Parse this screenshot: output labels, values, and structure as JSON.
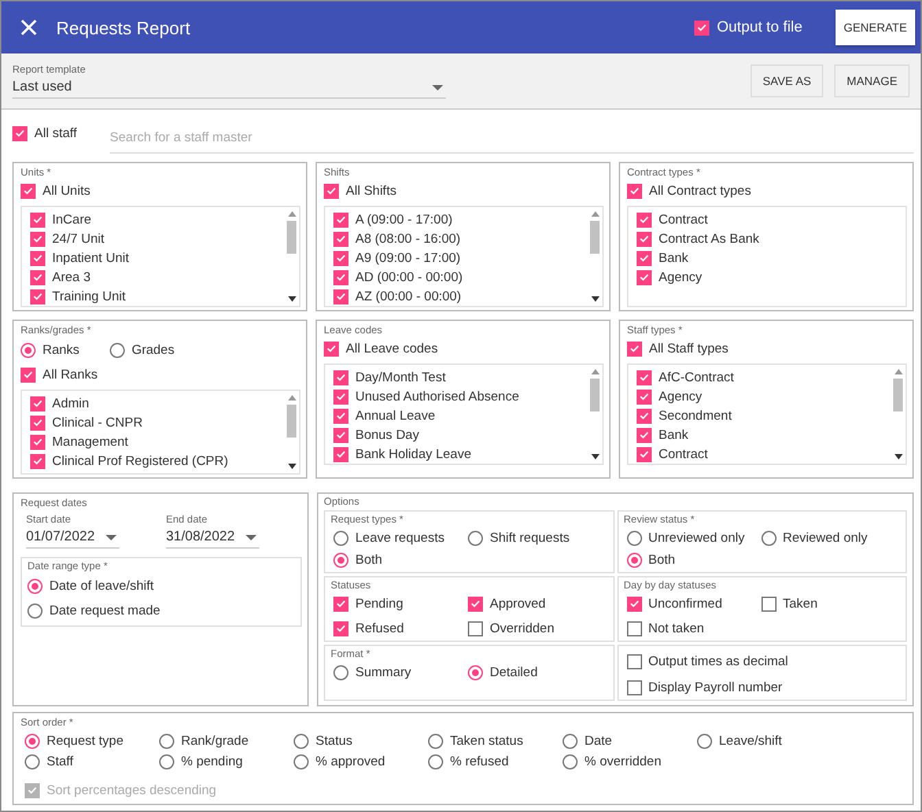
{
  "header": {
    "title": "Requests Report",
    "output_to_file": {
      "label": "Output to file",
      "checked": true
    },
    "generate": "GENERATE"
  },
  "template": {
    "label": "Report template",
    "value": "Last used",
    "buttons": [
      "SAVE AS",
      "MANAGE"
    ]
  },
  "staff": {
    "all_staff": {
      "label": "All staff",
      "checked": true
    },
    "search_placeholder": "Search for a staff master"
  },
  "filters": [
    {
      "title": "Units *",
      "kind": "scroll-list",
      "all": {
        "label": "All Units",
        "checked": true
      },
      "items": [
        {
          "label": "InCare",
          "checked": true
        },
        {
          "label": "24/7 Unit",
          "checked": true
        },
        {
          "label": "Inpatient Unit",
          "checked": true
        },
        {
          "label": "Area 3",
          "checked": true
        },
        {
          "label": "Training Unit",
          "checked": true
        }
      ]
    },
    {
      "title": "Shifts",
      "kind": "scroll-list",
      "all": {
        "label": "All Shifts",
        "checked": true
      },
      "items": [
        {
          "label": "A (09:00 - 17:00)",
          "checked": true
        },
        {
          "label": "A8 (08:00 - 16:00)",
          "checked": true
        },
        {
          "label": "A9 (09:00 - 17:00)",
          "checked": true
        },
        {
          "label": "AD (00:00 - 00:00)",
          "checked": true
        },
        {
          "label": "AZ (00:00 - 00:00)",
          "checked": true
        }
      ]
    },
    {
      "title": "Contract types *",
      "kind": "plain-list",
      "all": {
        "label": "All Contract types",
        "checked": true
      },
      "items": [
        {
          "label": "Contract",
          "checked": true
        },
        {
          "label": "Contract As Bank",
          "checked": true
        },
        {
          "label": "Bank",
          "checked": true
        },
        {
          "label": "Agency",
          "checked": true
        }
      ]
    },
    {
      "title": "Ranks/grades *",
      "kind": "scroll-list",
      "options": [
        {
          "label": "Ranks",
          "selected": true
        },
        {
          "label": "Grades",
          "selected": false
        }
      ],
      "all": {
        "label": "All Ranks",
        "checked": true
      },
      "items": [
        {
          "label": "Admin",
          "checked": true
        },
        {
          "label": "Clinical - CNPR",
          "checked": true
        },
        {
          "label": "Management",
          "checked": true
        },
        {
          "label": "Clinical Prof Registered (CPR)",
          "checked": true
        }
      ]
    },
    {
      "title": "Leave codes",
      "kind": "scroll-list",
      "all": {
        "label": "All Leave codes",
        "checked": true
      },
      "items": [
        {
          "label": "Day/Month Test",
          "checked": true
        },
        {
          "label": "Unused Authorised Absence",
          "checked": true
        },
        {
          "label": "Annual Leave",
          "checked": true
        },
        {
          "label": "Bonus Day",
          "checked": true
        },
        {
          "label": "Bank Holiday Leave",
          "checked": true
        }
      ]
    },
    {
      "title": "Staff types *",
      "kind": "scroll-list",
      "all": {
        "label": "All Staff types",
        "checked": true
      },
      "items": [
        {
          "label": "AfC-Contract",
          "checked": true
        },
        {
          "label": "Agency",
          "checked": true
        },
        {
          "label": "Secondment",
          "checked": true
        },
        {
          "label": "Bank",
          "checked": true
        },
        {
          "label": "Contract",
          "checked": true
        }
      ]
    }
  ],
  "request_dates": {
    "title": "Request dates",
    "start_date": {
      "label": "Start date",
      "value": "01/07/2022"
    },
    "end_date": {
      "label": "End date",
      "value": "31/08/2022"
    },
    "date_range_type": {
      "title": "Date range type *",
      "options": [
        {
          "label": "Date of leave/shift",
          "selected": true
        },
        {
          "label": "Date request made",
          "selected": false
        }
      ]
    }
  },
  "options": {
    "title": "Options",
    "groups": [
      {
        "title": "Request types *",
        "kind": "radio",
        "items": [
          {
            "label": "Leave requests",
            "selected": false
          },
          {
            "label": "Shift requests",
            "selected": false
          },
          {
            "label": "Both",
            "selected": true
          }
        ]
      },
      {
        "title": "Review status *",
        "kind": "radio",
        "items": [
          {
            "label": "Unreviewed only",
            "selected": false
          },
          {
            "label": "Reviewed only",
            "selected": false
          },
          {
            "label": "Both",
            "selected": true
          }
        ]
      },
      {
        "title": "Statuses",
        "kind": "check",
        "items": [
          {
            "label": "Pending",
            "checked": true
          },
          {
            "label": "Approved",
            "checked": true
          },
          {
            "label": "Refused",
            "checked": true
          },
          {
            "label": "Overridden",
            "checked": false
          }
        ]
      },
      {
        "title": "Day by day statuses",
        "kind": "check",
        "items": [
          {
            "label": "Unconfirmed",
            "checked": true
          },
          {
            "label": "Taken",
            "checked": false
          },
          {
            "label": "Not taken",
            "checked": false
          }
        ]
      },
      {
        "title": "Format *",
        "kind": "radio",
        "items": [
          {
            "label": "Summary",
            "selected": false
          },
          {
            "label": "Detailed",
            "selected": true
          }
        ]
      },
      {
        "kind": "check-stack",
        "items": [
          {
            "label": "Output times as decimal",
            "checked": false
          },
          {
            "label": "Display Payroll number",
            "checked": false
          }
        ]
      }
    ]
  },
  "sort_order": {
    "title": "Sort order *",
    "options": [
      {
        "label": "Request type",
        "selected": true
      },
      {
        "label": "Rank/grade",
        "selected": false
      },
      {
        "label": "Status",
        "selected": false
      },
      {
        "label": "Taken status",
        "selected": false
      },
      {
        "label": "Date",
        "selected": false
      },
      {
        "label": "Leave/shift",
        "selected": false
      },
      {
        "label": "Staff",
        "selected": false
      },
      {
        "label": "% pending",
        "selected": false
      },
      {
        "label": "% approved",
        "selected": false
      },
      {
        "label": "% refused",
        "selected": false
      },
      {
        "label": "% overridden",
        "selected": false
      }
    ],
    "descending": {
      "label": "Sort percentages descending",
      "checked": true,
      "disabled": true
    }
  }
}
